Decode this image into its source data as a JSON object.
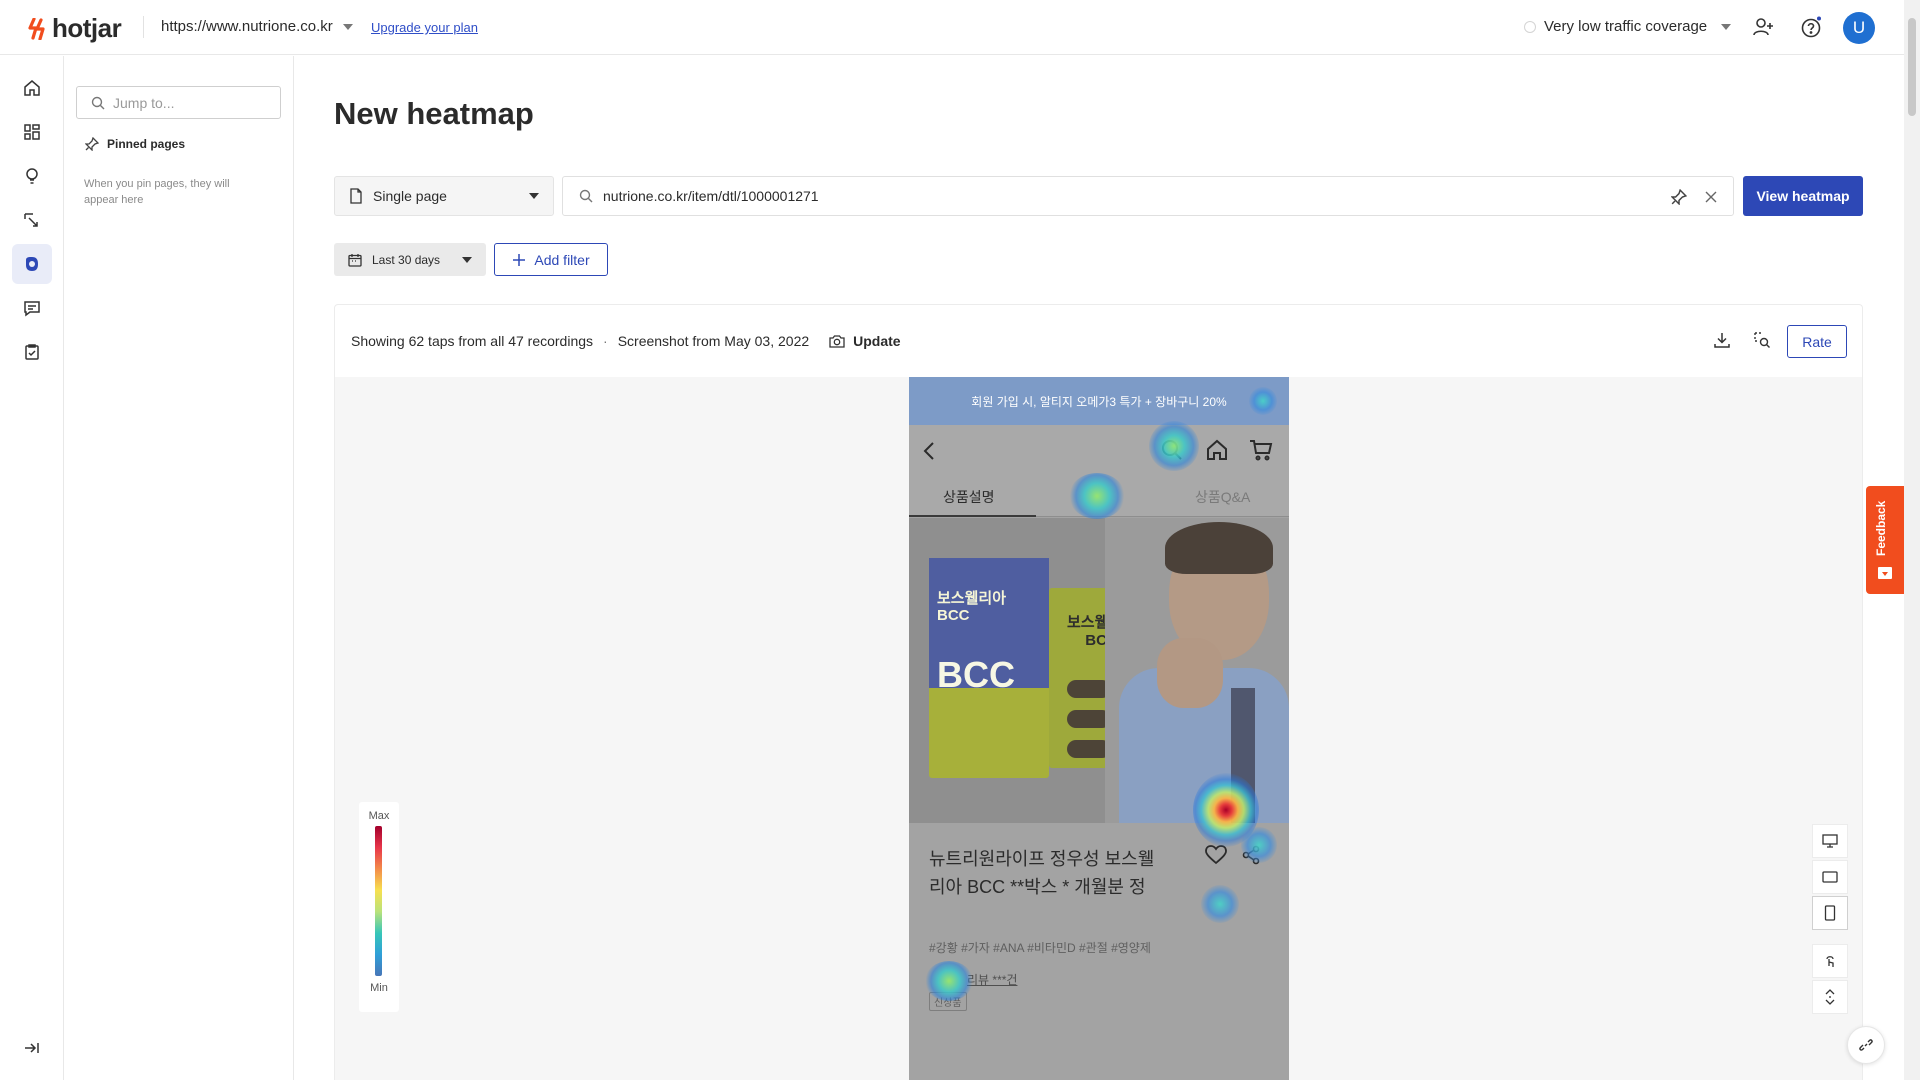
{
  "topbar": {
    "logo": "hotjar",
    "site_url": "https://www.nutrione.co.kr",
    "upgrade": "Upgrade your plan",
    "traffic": "Very low traffic coverage",
    "avatar": "U"
  },
  "pages_panel": {
    "jump_placeholder": "Jump to...",
    "pinned_title": "Pinned pages",
    "pinned_desc": "When you pin pages, they will appear here"
  },
  "main": {
    "title": "New heatmap",
    "page_type": "Single page",
    "url_value": "nutrione.co.kr/item/dtl/1000001271",
    "view_button": "View heatmap",
    "date_range": "Last 30 days",
    "add_filter": "Add filter"
  },
  "card": {
    "showing": "Showing 62 taps from all 47 recordings",
    "separator": "·",
    "screenshot": "Screenshot from May 03, 2022",
    "update": "Update",
    "rate": "Rate"
  },
  "legend": {
    "max": "Max",
    "min": "Min"
  },
  "phone": {
    "banner": "회원 가입 시, 알티지 오메가3 특가 + 장바구니 20%",
    "tabs": [
      "상품설명",
      "상품Q&A"
    ],
    "box1_brand": "보스웰리아\nBCC",
    "box1_big": "BCC",
    "box2_brand": "보스웰리아\nBCC",
    "product_title": "뉴트리원라이프 정우성 보스웰리아 BCC **박스 * 개월분 정",
    "tags": "#강황 #가자 #ANA #비타민D #관절 #영양제",
    "review": "리뷰 ***건",
    "new_tag": "신상품"
  },
  "feedback": "Feedback",
  "colors": {
    "accent": "#2d48b6",
    "feedback": "#f14d1e",
    "avatar": "#1f6fd1",
    "logo_mark": "#f14d1e"
  },
  "icons": {
    "rail": [
      "home-icon",
      "dashboard-icon",
      "lightbulb-icon",
      "recordings-icon",
      "heatmaps-icon",
      "feedback-icon",
      "surveys-icon"
    ],
    "collapse": "collapse-sidebar-icon"
  }
}
